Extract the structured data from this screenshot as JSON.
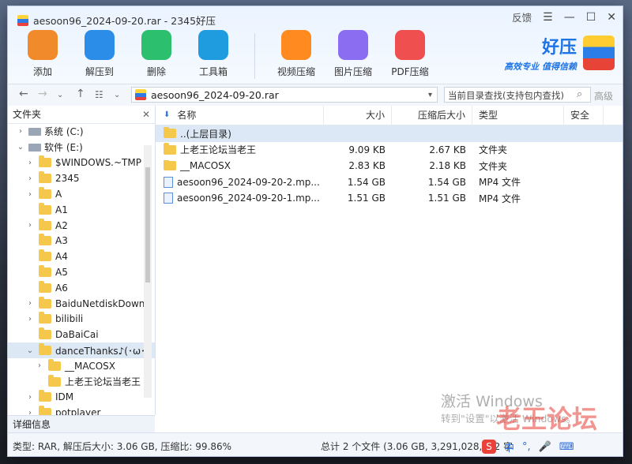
{
  "window": {
    "title": "aesoon96_2024-09-20.rar - 2345好压",
    "feedback_label": "反馈"
  },
  "toolbar": [
    {
      "label": "添加",
      "icon": "add-archive-icon",
      "color": "#f08a2b"
    },
    {
      "label": "解压到",
      "icon": "extract-icon",
      "color": "#2b8de8"
    },
    {
      "label": "删除",
      "icon": "recycle-icon",
      "color": "#2bbf6e"
    },
    {
      "label": "工具箱",
      "icon": "toolbox-icon",
      "color": "#1f9be0"
    },
    {
      "label": "视频压缩",
      "icon": "video-compress-icon",
      "color": "#ff8a20"
    },
    {
      "label": "图片压缩",
      "icon": "image-compress-icon",
      "color": "#8a6df0"
    },
    {
      "label": "PDF压缩",
      "icon": "pdf-compress-icon",
      "color": "#ef4f4f"
    }
  ],
  "brand": {
    "name": "好压",
    "slogan": "高效专业  值得信赖"
  },
  "address": {
    "path": "aesoon96_2024-09-20.rar"
  },
  "search": {
    "placeholder": "当前目录查找(支持包内查找)",
    "advanced_label": "高级"
  },
  "sidebar": {
    "title": "文件夹",
    "items": [
      {
        "label": "系统 (C:)",
        "indent": 1,
        "caret": ">",
        "type": "drive"
      },
      {
        "label": "软件 (E:)",
        "indent": 1,
        "caret": "v",
        "type": "drive"
      },
      {
        "label": "$WINDOWS.~TMP",
        "indent": 2,
        "caret": ">",
        "type": "folder"
      },
      {
        "label": "2345",
        "indent": 2,
        "caret": ">",
        "type": "folder"
      },
      {
        "label": "A",
        "indent": 2,
        "caret": ">",
        "type": "folder"
      },
      {
        "label": "A1",
        "indent": 2,
        "caret": "",
        "type": "folder"
      },
      {
        "label": "A2",
        "indent": 2,
        "caret": ">",
        "type": "folder"
      },
      {
        "label": "A3",
        "indent": 2,
        "caret": "",
        "type": "folder"
      },
      {
        "label": "A4",
        "indent": 2,
        "caret": "",
        "type": "folder"
      },
      {
        "label": "A5",
        "indent": 2,
        "caret": "",
        "type": "folder"
      },
      {
        "label": "A6",
        "indent": 2,
        "caret": "",
        "type": "folder"
      },
      {
        "label": "BaiduNetdiskDownl",
        "indent": 2,
        "caret": ">",
        "type": "folder"
      },
      {
        "label": "bilibili",
        "indent": 2,
        "caret": ">",
        "type": "folder"
      },
      {
        "label": "DaBaiCai",
        "indent": 2,
        "caret": "",
        "type": "folder"
      },
      {
        "label": "danceThanks♪(･ω･)",
        "indent": 2,
        "caret": "v",
        "type": "folder",
        "selected": true
      },
      {
        "label": "__MACOSX",
        "indent": 3,
        "caret": ">",
        "type": "folder"
      },
      {
        "label": "上老王论坛当老王",
        "indent": 3,
        "caret": "",
        "type": "folder"
      },
      {
        "label": "IDM",
        "indent": 2,
        "caret": ">",
        "type": "folder"
      },
      {
        "label": "potplayer",
        "indent": 2,
        "caret": ">",
        "type": "folder"
      }
    ],
    "detail_label": "详细信息"
  },
  "columns": {
    "name": "名称",
    "size": "大小",
    "packed": "压缩后大小",
    "type": "类型",
    "security": "安全"
  },
  "files": [
    {
      "name": "..(上层目录)",
      "size": "",
      "packed": "",
      "type": "",
      "kind": "folder",
      "selected": true
    },
    {
      "name": "上老王论坛当老王",
      "size": "9.09 KB",
      "packed": "2.67 KB",
      "type": "文件夹",
      "kind": "folder"
    },
    {
      "name": "__MACOSX",
      "size": "2.83 KB",
      "packed": "2.18 KB",
      "type": "文件夹",
      "kind": "folder"
    },
    {
      "name": "aesoon96_2024-09-20-2.mp...",
      "size": "1.54 GB",
      "packed": "1.54 GB",
      "type": "MP4 文件",
      "kind": "mp4"
    },
    {
      "name": "aesoon96_2024-09-20-1.mp...",
      "size": "1.51 GB",
      "packed": "1.51 GB",
      "type": "MP4 文件",
      "kind": "mp4"
    }
  ],
  "status": {
    "left": "类型: RAR, 解压后大小: 3.06 GB, 压缩比: 99.86%",
    "right": "总计 2 个文件 (3.06 GB, 3,291,028,282 字"
  },
  "watermark": {
    "activate_title": "激活 Windows",
    "activate_sub": "转到\"设置\"以激活 Windows。",
    "site": "老王论坛"
  },
  "tray": {
    "ime_label": "中",
    "sogou_label": "S"
  }
}
